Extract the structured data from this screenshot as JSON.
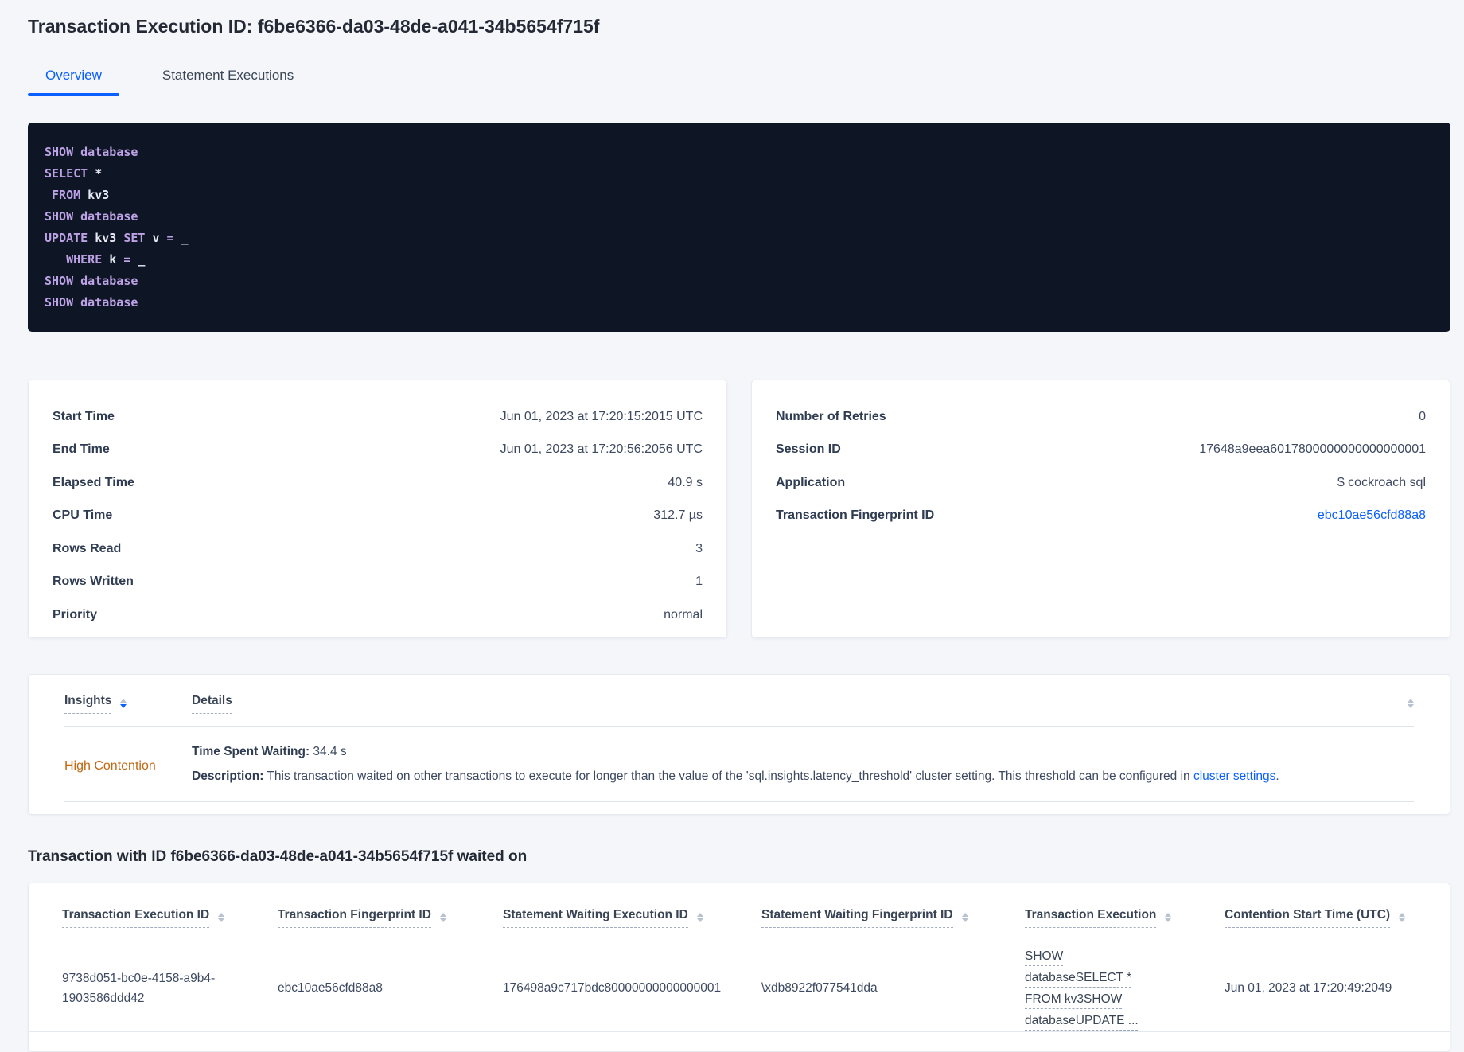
{
  "page": {
    "title": "Transaction Execution ID: f6be6366-da03-48de-a041-34b5654f715f"
  },
  "colors": {
    "accent_blue": "#0b5fff",
    "warning_orange": "#c2660f",
    "code_background": "#0e1626",
    "code_keyword": "#bda2e6",
    "code_identifier": "#e7e9f2"
  },
  "icons": {
    "sort": "sort-arrows-icon"
  },
  "tabs": [
    {
      "label": "Overview",
      "active": true
    },
    {
      "label": "Statement Executions",
      "active": false
    }
  ],
  "sql": {
    "lines": [
      [
        [
          "kw",
          "SHOW database"
        ]
      ],
      [
        [
          "kw",
          "SELECT"
        ],
        [
          "id",
          " *"
        ]
      ],
      [
        [
          "id",
          " "
        ],
        [
          "kw",
          "FROM"
        ],
        [
          "id",
          " kv3"
        ]
      ],
      [
        [
          "kw",
          "SHOW database"
        ]
      ],
      [
        [
          "kw",
          "UPDATE"
        ],
        [
          "id",
          " kv3 "
        ],
        [
          "kw",
          "SET"
        ],
        [
          "id",
          " v "
        ],
        [
          "kw",
          "="
        ],
        [
          "id",
          " _"
        ]
      ],
      [
        [
          "id",
          "   "
        ],
        [
          "kw",
          "WHERE"
        ],
        [
          "id",
          " k "
        ],
        [
          "kw",
          "="
        ],
        [
          "id",
          " _"
        ]
      ],
      [
        [
          "kw",
          "SHOW database"
        ]
      ],
      [
        [
          "kw",
          "SHOW database"
        ]
      ]
    ]
  },
  "stats_left": {
    "rows": [
      {
        "label": "Start Time",
        "value": "Jun 01, 2023 at 17:20:15:2015 UTC"
      },
      {
        "label": "End Time",
        "value": "Jun 01, 2023 at 17:20:56:2056 UTC"
      },
      {
        "label": "Elapsed Time",
        "value": "40.9 s"
      },
      {
        "label": "CPU Time",
        "value": "312.7 µs"
      },
      {
        "label": "Rows Read",
        "value": "3"
      },
      {
        "label": "Rows Written",
        "value": "1"
      },
      {
        "label": "Priority",
        "value": "normal"
      }
    ]
  },
  "stats_right": {
    "rows": [
      {
        "label": "Number of Retries",
        "value": "0"
      },
      {
        "label": "Session ID",
        "value": "17648a9eea6017800000000000000001"
      },
      {
        "label": "Application",
        "value": "$ cockroach sql"
      },
      {
        "label": "Transaction Fingerprint ID",
        "value": "ebc10ae56cfd88a8"
      }
    ]
  },
  "insights": {
    "columns": [
      {
        "label": "Insights"
      },
      {
        "label": "Details"
      }
    ],
    "row": {
      "insight": "High Contention",
      "waiting_label": "Time Spent Waiting:",
      "waiting_value": " 34.4 s",
      "description_label": "Description:",
      "description_text": " This transaction waited on other transactions to execute for longer than the value of the 'sql.insights.latency_threshold' cluster setting. This threshold can be configured in ",
      "description_link": "cluster settings",
      "description_end": "."
    }
  },
  "waited_on": {
    "heading": "Transaction with ID f6be6366-da03-48de-a041-34b5654f715f waited on",
    "columns": [
      "Transaction Execution ID",
      "Transaction Fingerprint ID",
      "Statement Waiting Execution ID",
      "Statement Waiting Fingerprint ID",
      "Transaction Execution",
      "Contention Start Time (UTC)"
    ],
    "row": {
      "transaction_execution_id": "9738d051-bc0e-4158-a9b4-1903586ddd42",
      "transaction_fingerprint_id": "ebc10ae56cfd88a8",
      "statement_waiting_execution_id": "176498a9c717bdc80000000000000001",
      "statement_waiting_fingerprint_id": "\\xdb8922f077541dda",
      "transaction_execution": "SHOW databaseSELECT * FROM kv3SHOW databaseUPDATE ...",
      "contention_start_time": "Jun 01, 2023 at 17:20:49:2049"
    }
  }
}
